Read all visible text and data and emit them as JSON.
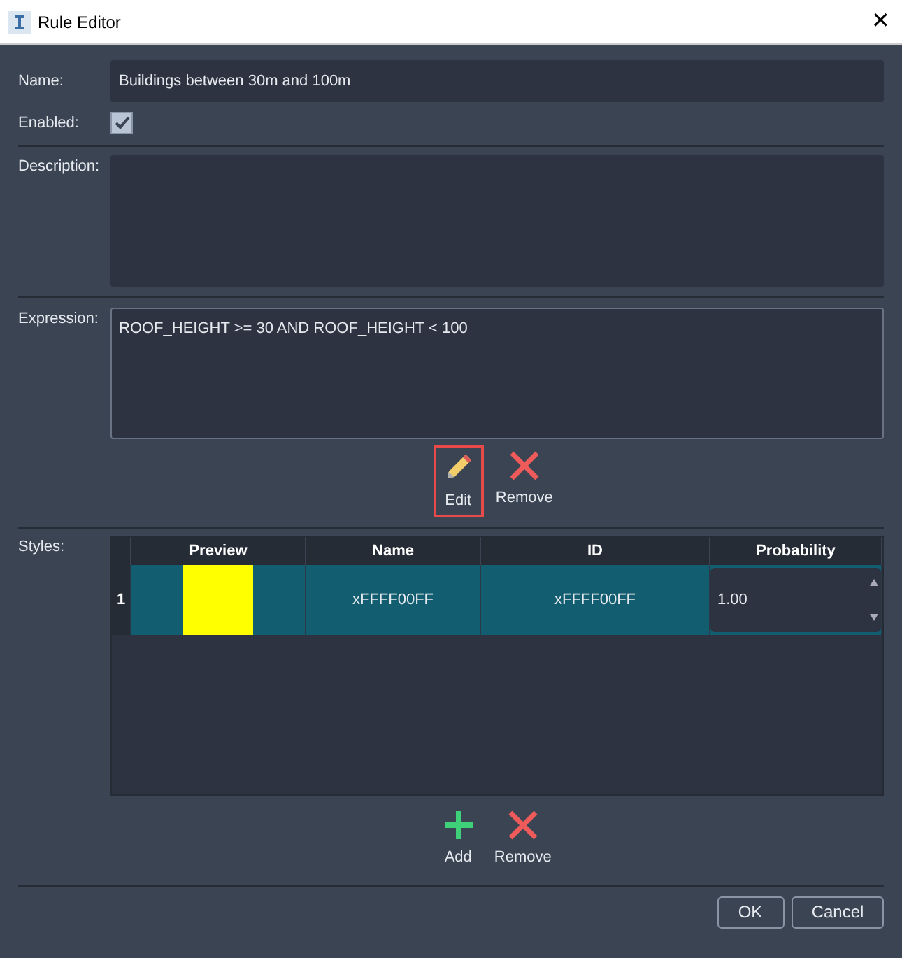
{
  "window": {
    "title": "Rule Editor",
    "close": "✕"
  },
  "name": {
    "label": "Name:",
    "value": "Buildings between 30m and 100m"
  },
  "enabled": {
    "label": "Enabled:",
    "checked": true
  },
  "description": {
    "label": "Description:"
  },
  "expression": {
    "label": "Expression:",
    "value": "ROOF_HEIGHT >= 30 AND ROOF_HEIGHT < 100"
  },
  "expression_actions": [
    {
      "kind": "edit",
      "label": "Edit",
      "focused": true
    },
    {
      "kind": "remove",
      "label": "Remove",
      "focused": false
    }
  ],
  "styles": {
    "label": "Styles:",
    "columns": [
      "Preview",
      "Name",
      "ID",
      "Probability"
    ],
    "rows": [
      {
        "number": "1",
        "color": "#ffff00",
        "name": "xFFFF00FF",
        "id": "xFFFF00FF",
        "probability": "1.00",
        "selected": true
      }
    ]
  },
  "style_actions": [
    {
      "kind": "add",
      "label": "Add",
      "focused": false
    },
    {
      "kind": "remove",
      "label": "Remove",
      "focused": false
    }
  ],
  "buttons": [
    "OK",
    "Cancel"
  ]
}
